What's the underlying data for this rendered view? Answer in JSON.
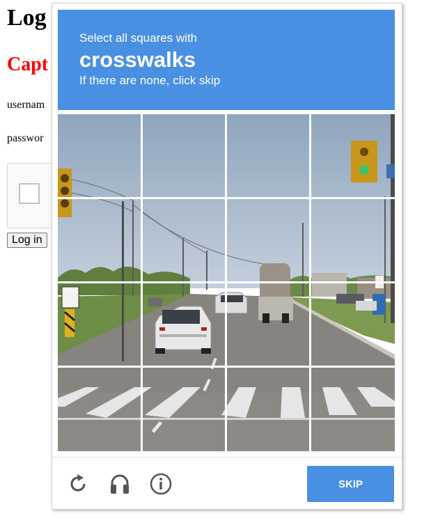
{
  "page": {
    "title": "Log",
    "captcha_heading": "Capt",
    "username_label": "usernam",
    "password_label": "passwor",
    "login_button": "Log in"
  },
  "challenge": {
    "instruction": "Select all squares with",
    "object": "crosswalks",
    "hint": "If there are none, click skip",
    "grid_rows": 4,
    "grid_cols": 4,
    "banner_color": "#4a90e2",
    "skip_label": "SKIP",
    "footer_icons": [
      "reload-icon",
      "headphones-icon",
      "info-icon"
    ]
  }
}
